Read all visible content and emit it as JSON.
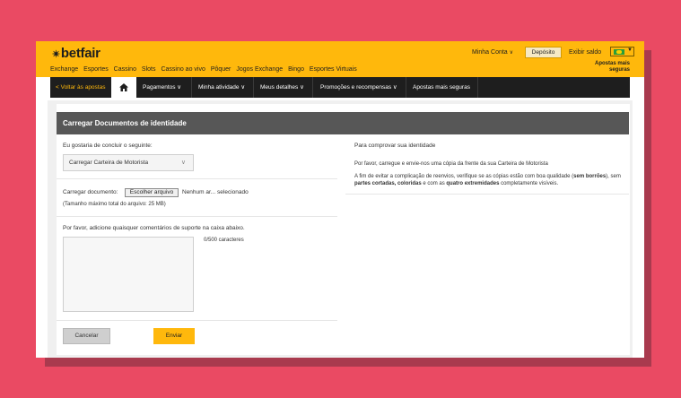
{
  "brand": {
    "logo_mark": "✴",
    "logo_text": "betfair"
  },
  "nav": {
    "items": [
      "Exchange",
      "Esportes",
      "Cassino",
      "Slots",
      "Cassino ao vivo",
      "Pôquer",
      "Jogos Exchange",
      "Bingo",
      "Esportes Virtuais"
    ]
  },
  "account": {
    "my_account": "Minha Conta",
    "deposit": "Depósito",
    "show_balance": "Exibir saldo",
    "safe_bets_1": "Apostas mais",
    "safe_bets_2": "seguras"
  },
  "subnav": {
    "back": "< Voltar às apostas",
    "payments": "Pagamentos",
    "activity": "Minha atividade",
    "details": "Meus detalhes",
    "promotions": "Promoções e recompensas",
    "safer_betting": "Apostas mais seguras"
  },
  "panel": {
    "title": "Carregar Documentos de identidade",
    "complete_label": "Eu gostaria de concluir o seguinte:",
    "select_value": "Carregar Carteira de Motorista",
    "upload_label": "Carregar documento:",
    "choose_file": "Escolher arquivo",
    "no_file": "Nenhum ar... selecionado",
    "max_size": "(Tamanho máximo total do arquivo: 25 MB)",
    "comments_label": "Por favor, adicione quaisquer comentários de suporte na caixa abaixo.",
    "char_count": "0/500 caracteres",
    "cancel": "Cancelar",
    "submit": "Enviar"
  },
  "info": {
    "title": "Para comprovar sua identidade",
    "p1": "Por favor, carregue e envie-nos uma cópia da frente da sua Carteira de Motorista",
    "p2_a": "A fim de evitar a complicação de reenvios, verifique se as cópias estão com boa qualidade (",
    "p2_b": "sem borrões",
    "p2_c": "), sem ",
    "p2_d": "partes cortadas, coloridas",
    "p2_e": " e com as ",
    "p2_f": "quatro extremidades",
    "p2_g": " completamente visíveis."
  },
  "colors": {
    "brand": "#ffb80c",
    "dark": "#1e1e1e",
    "background": "#ea4a63",
    "header": "#575757"
  }
}
